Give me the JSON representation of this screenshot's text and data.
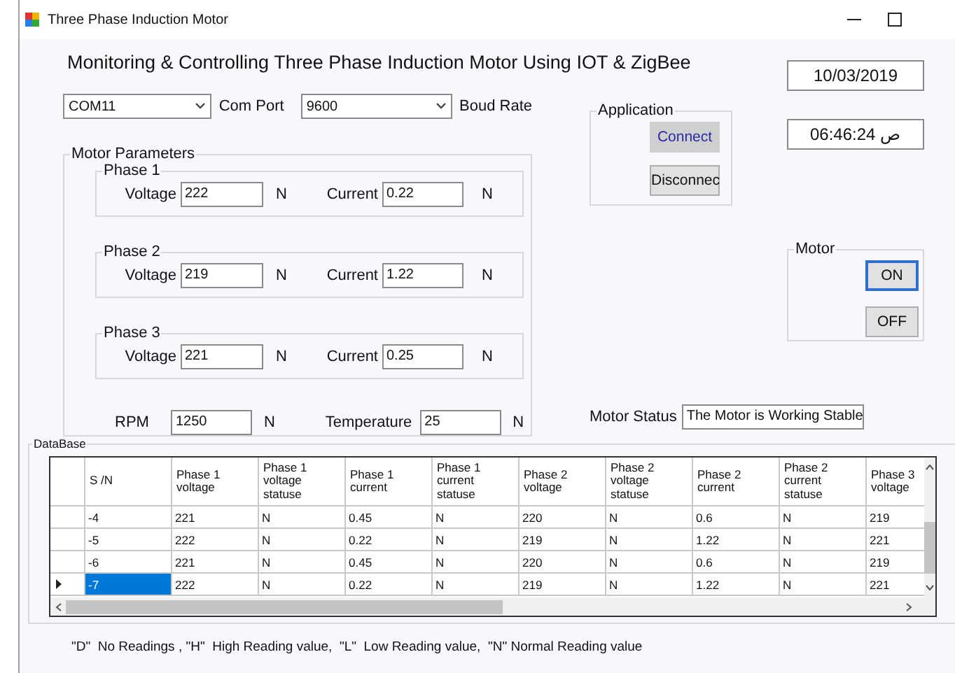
{
  "window": {
    "title": "Three Phase Induction Motor"
  },
  "heading": "Monitoring & Controlling Three Phase Induction Motor Using IOT & ZigBee",
  "date": "10/03/2019",
  "time": "06:46:24 ص",
  "com_port": {
    "value": "COM11",
    "label": "Com Port"
  },
  "baud_rate": {
    "value": "9600",
    "label": "Boud Rate"
  },
  "application": {
    "title": "Application",
    "buttons": [
      {
        "label": "Connect",
        "hovered": true
      },
      {
        "label": "Disconnec",
        "hovered": false
      }
    ]
  },
  "motor_parameters": {
    "title": "Motor Parameters",
    "phases": [
      {
        "title": "Phase 1",
        "voltage_label": "Voltage",
        "voltage": "222",
        "voltage_status": "N",
        "current_label": "Current",
        "current": "0.22",
        "current_status": "N"
      },
      {
        "title": "Phase 2",
        "voltage_label": "Voltage",
        "voltage": "219",
        "voltage_status": "N",
        "current_label": "Current",
        "current": "1.22",
        "current_status": "N"
      },
      {
        "title": "Phase 3",
        "voltage_label": "Voltage",
        "voltage": "221",
        "voltage_status": "N",
        "current_label": "Current",
        "current": "0.25",
        "current_status": "N"
      }
    ],
    "rpm": {
      "label": "RPM",
      "value": "1250",
      "status": "N"
    },
    "temperature": {
      "label": "Temperature",
      "value": "25",
      "status": "N"
    }
  },
  "motor": {
    "title": "Motor",
    "buttons": [
      {
        "label": "ON",
        "focused": true
      },
      {
        "label": "OFF",
        "focused": false
      }
    ]
  },
  "motor_status": {
    "label": "Motor Status",
    "value": "The Motor is Working Stable"
  },
  "database": {
    "title": "DataBase",
    "columns": [
      "S /N",
      "Phase 1\nvoltage",
      "Phase 1\nvoltage\nstatuse",
      "Phase 1\ncurrent",
      "Phase 1\ncurrent\nstatuse",
      "Phase 2\nvoltage",
      "Phase 2\nvoltage\nstatuse",
      "Phase 2\ncurrent",
      "Phase 2\ncurrent\nstatuse",
      "Phase 3\nvoltage"
    ],
    "rows": [
      {
        "selected": false,
        "cells": [
          "-4",
          "221",
          "N",
          "0.45",
          "N",
          "220",
          "N",
          "0.6",
          "N",
          "219"
        ]
      },
      {
        "selected": false,
        "cells": [
          "-5",
          "222",
          "N",
          "0.22",
          "N",
          "219",
          "N",
          "1.22",
          "N",
          "221"
        ]
      },
      {
        "selected": false,
        "cells": [
          "-6",
          "221",
          "N",
          "0.45",
          "N",
          "220",
          "N",
          "0.6",
          "N",
          "219"
        ]
      },
      {
        "selected": true,
        "cells": [
          "-7",
          "222",
          "N",
          "0.22",
          "N",
          "219",
          "N",
          "1.22",
          "N",
          "221"
        ]
      }
    ]
  },
  "legend": "\"D\"  No Readings , \"H\"  High Reading value,  \"L\"  Low Reading value,  \"N\" Normal Reading value"
}
